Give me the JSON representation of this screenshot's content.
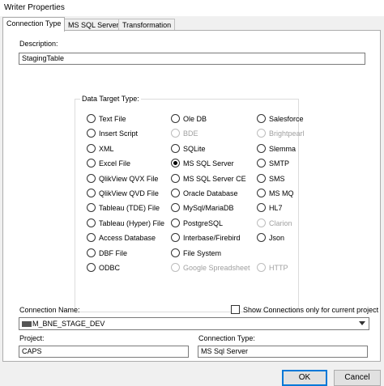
{
  "window": {
    "title": "Writer Properties"
  },
  "tabs": [
    {
      "label": "Connection Type",
      "active": true
    },
    {
      "label": "MS SQL Server",
      "active": false
    },
    {
      "label": "Transformation",
      "active": false
    }
  ],
  "description": {
    "label": "Description:",
    "value": "StagingTable"
  },
  "data_target": {
    "label": "Data Target Type:",
    "selected": "MS SQL Server",
    "columns": [
      [
        {
          "label": "Text File",
          "disabled": false
        },
        {
          "label": "Insert Script",
          "disabled": false
        },
        {
          "label": "XML",
          "disabled": false
        },
        {
          "label": "Excel File",
          "disabled": false
        },
        {
          "label": "QlikView QVX File",
          "disabled": false
        },
        {
          "label": "QlikView QVD File",
          "disabled": false
        },
        {
          "label": "Tableau (TDE) File",
          "disabled": false
        },
        {
          "label": "Tableau (Hyper) File",
          "disabled": false
        },
        {
          "label": "Access Database",
          "disabled": false
        },
        {
          "label": "DBF File",
          "disabled": false
        },
        {
          "label": "ODBC",
          "disabled": false
        }
      ],
      [
        {
          "label": "Ole DB",
          "disabled": false
        },
        {
          "label": "BDE",
          "disabled": true
        },
        {
          "label": "SQLite",
          "disabled": false
        },
        {
          "label": "MS SQL Server",
          "disabled": false
        },
        {
          "label": "MS SQL Server CE",
          "disabled": false
        },
        {
          "label": "Oracle Database",
          "disabled": false
        },
        {
          "label": "MySql/MariaDB",
          "disabled": false
        },
        {
          "label": "PostgreSQL",
          "disabled": false
        },
        {
          "label": "Interbase/Firebird",
          "disabled": false
        },
        {
          "label": "File System",
          "disabled": false
        },
        {
          "label": "Google Spreadsheet",
          "disabled": true
        }
      ],
      [
        {
          "label": "Salesforce",
          "disabled": false
        },
        {
          "label": "Brightpearl",
          "disabled": true
        },
        {
          "label": "Slemma",
          "disabled": false
        },
        {
          "label": "SMTP",
          "disabled": false
        },
        {
          "label": "SMS",
          "disabled": false
        },
        {
          "label": "MS MQ",
          "disabled": false
        },
        {
          "label": "HL7",
          "disabled": false
        },
        {
          "label": "Clarion",
          "disabled": true
        },
        {
          "label": "Json",
          "disabled": false
        },
        {
          "label": "",
          "disabled": false
        },
        {
          "label": "HTTP",
          "disabled": true
        }
      ]
    ]
  },
  "connection": {
    "name_label": "Connection Name:",
    "show_only_label": "Show Connections only for current project",
    "show_only_checked": false,
    "value": "M_BNE_STAGE_DEV"
  },
  "project": {
    "label": "Project:",
    "value": "CAPS"
  },
  "connection_type": {
    "label": "Connection Type:",
    "value": "MS Sql Server"
  },
  "buttons": {
    "ok": "OK",
    "cancel": "Cancel"
  }
}
